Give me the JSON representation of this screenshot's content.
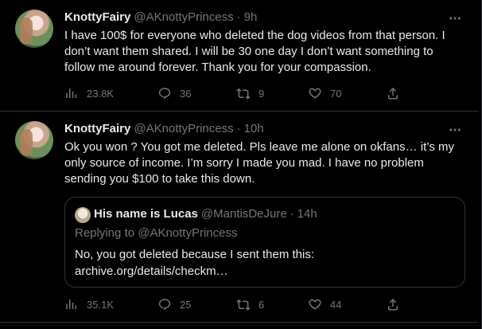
{
  "tweets": [
    {
      "name": "KnottyFairy",
      "handle": "@AKnottyPrincess",
      "dot": "·",
      "time": "9h",
      "text": "I have 100$ for everyone who deleted the dog videos from that person. I don’t want them shared. I will be 30 one day I don’t want something to follow me around forever.  Thank you for your compassion.",
      "views": "23.8K",
      "replies": "36",
      "retweets": "9",
      "likes": "70"
    },
    {
      "name": "KnottyFairy",
      "handle": "@AKnottyPrincess",
      "dot": "·",
      "time": "10h",
      "text": "Ok you won ? You got me deleted. Pls leave me alone on okfans… it’s my only source of income. I’m sorry I made you mad. I have no problem sending you $100 to take this down.",
      "views": "35.1K",
      "replies": "25",
      "retweets": "6",
      "likes": "44",
      "quote": {
        "name": "His name is Lucas",
        "handle": "@MantisDeJure",
        "dot": "·",
        "time": "14h",
        "replying_prefix": "Replying to ",
        "replying_handle": "@AKnottyPrincess",
        "text": "No, you got deleted because I sent them this: archive.org/details/checkm…"
      }
    }
  ],
  "icons": {
    "more": "more-dots-icon",
    "views": "bar-chart-icon",
    "reply": "speech-bubble-icon",
    "retweet": "retweet-arrows-icon",
    "like": "heart-icon",
    "share": "share-upload-icon"
  },
  "colors": {
    "background": "#000000",
    "text": "#e7e9ea",
    "muted": "#71767b",
    "border": "#2f3336"
  }
}
